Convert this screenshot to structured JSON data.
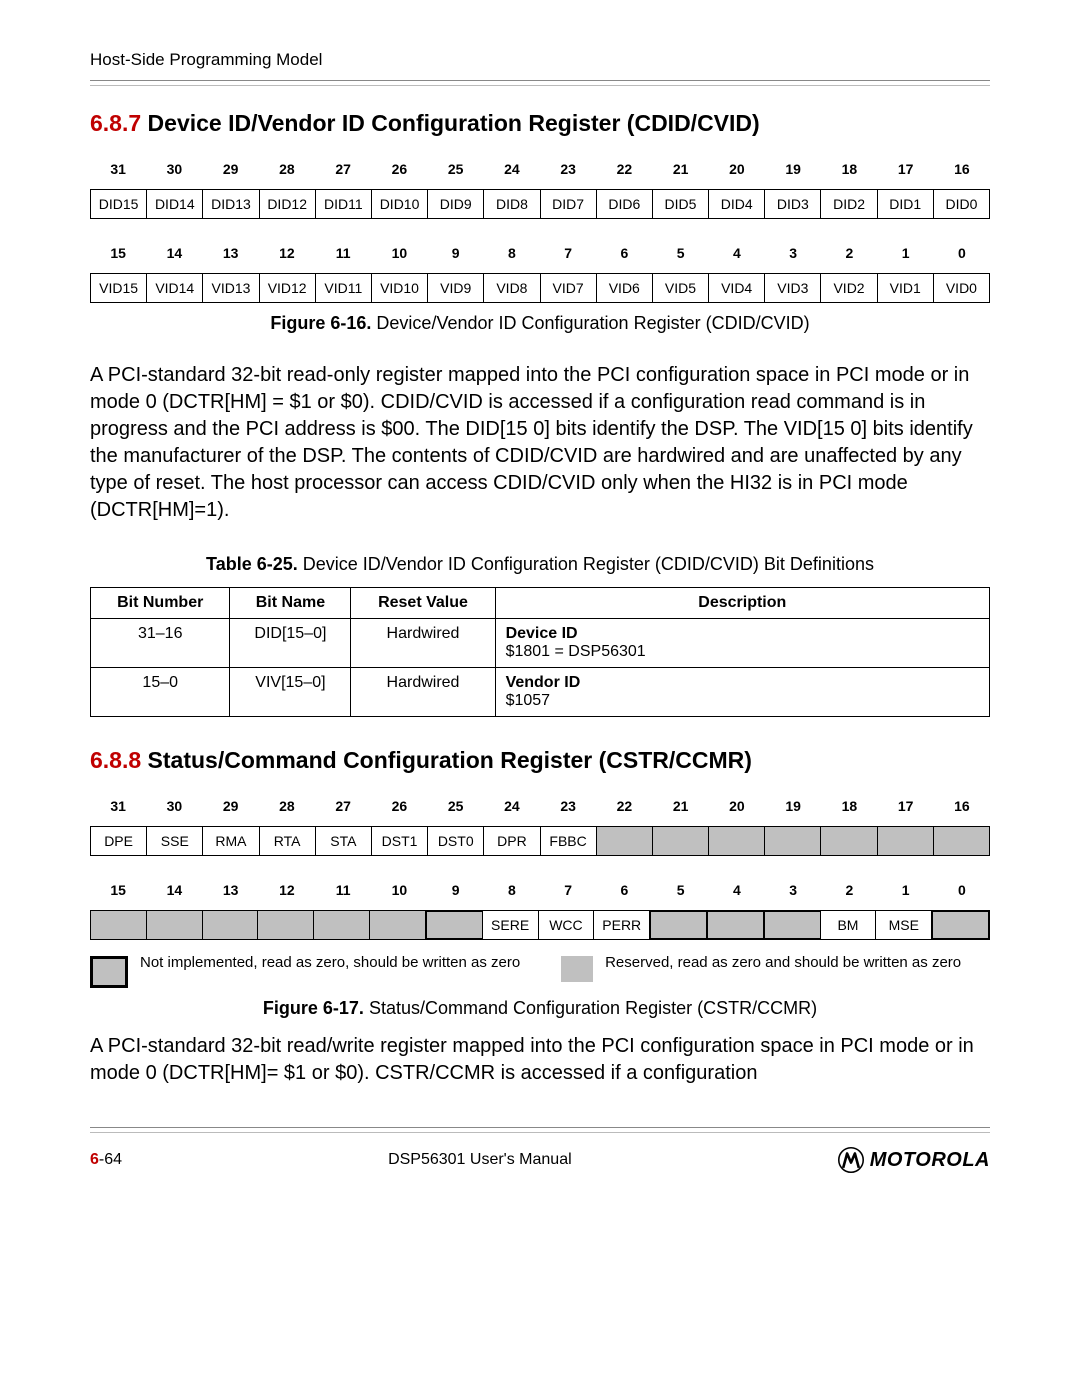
{
  "page": {
    "running_head": "Host-Side Programming Model",
    "footer_page_chapter": "6",
    "footer_page_num": "-64",
    "footer_center": "DSP56301 User's Manual",
    "footer_logo_text": "MOTOROLA"
  },
  "sec687": {
    "num": "6.8.7",
    "title": " Device ID/Vendor ID Configuration Register (CDID/CVID)",
    "fig_label": "Figure 6-16.",
    "fig_title": " Device/Vendor ID Configuration Register (CDID/CVID)",
    "body": "A PCI-standard 32-bit read-only register mapped into the PCI configuration space in PCI mode or in mode 0 (DCTR[HM] = $1 or $0). CDID/CVID is accessed if a configuration read command is in progress and the PCI address is $00. The DID[15 0] bits identify the DSP. The VID[15 0] bits identify the manufacturer of the DSP. The contents of CDID/CVID are hardwired and are unaffected by any type of reset. The host processor can access CDID/CVID only when the HI32 is in PCI mode (DCTR[HM]=1).",
    "row1_nums": [
      "31",
      "30",
      "29",
      "28",
      "27",
      "26",
      "25",
      "24",
      "23",
      "22",
      "21",
      "20",
      "19",
      "18",
      "17",
      "16"
    ],
    "row1_bits": [
      "DID15",
      "DID14",
      "DID13",
      "DID12",
      "DID11",
      "DID10",
      "DID9",
      "DID8",
      "DID7",
      "DID6",
      "DID5",
      "DID4",
      "DID3",
      "DID2",
      "DID1",
      "DID0"
    ],
    "row2_nums": [
      "15",
      "14",
      "13",
      "12",
      "11",
      "10",
      "9",
      "8",
      "7",
      "6",
      "5",
      "4",
      "3",
      "2",
      "1",
      "0"
    ],
    "row2_bits": [
      "VID15",
      "VID14",
      "VID13",
      "VID12",
      "VID11",
      "VID10",
      "VID9",
      "VID8",
      "VID7",
      "VID6",
      "VID5",
      "VID4",
      "VID3",
      "VID2",
      "VID1",
      "VID0"
    ]
  },
  "table625": {
    "label": "Table 6-25.",
    "title": " Device ID/Vendor ID Configuration Register (CDID/CVID) Bit Definitions",
    "headers": [
      "Bit Number",
      "Bit Name",
      "Reset Value",
      "Description"
    ],
    "rows": [
      {
        "num": "31–16",
        "name": "DID[15–0]",
        "reset": "Hardwired",
        "desc_b": "Device ID",
        "desc": "\n$1801 = DSP56301"
      },
      {
        "num": "15–0",
        "name": "VIV[15–0]",
        "reset": "Hardwired",
        "desc_b": "Vendor ID",
        "desc": "\n$1057"
      }
    ]
  },
  "sec688": {
    "num": "6.8.8",
    "title": " Status/Command Configuration Register (CSTR/CCMR)",
    "row1_nums": [
      "31",
      "30",
      "29",
      "28",
      "27",
      "26",
      "25",
      "24",
      "23",
      "22",
      "21",
      "20",
      "19",
      "18",
      "17",
      "16"
    ],
    "row1_bits": [
      {
        "t": "DPE",
        "gray": false
      },
      {
        "t": "SSE",
        "gray": false
      },
      {
        "t": "RMA",
        "gray": false
      },
      {
        "t": "RTA",
        "gray": false
      },
      {
        "t": "STA",
        "gray": false
      },
      {
        "t": "DST1",
        "gray": false
      },
      {
        "t": "DST0",
        "gray": false
      },
      {
        "t": "DPR",
        "gray": false
      },
      {
        "t": "FBBC",
        "gray": false
      },
      {
        "t": "",
        "gray": true
      },
      {
        "t": "",
        "gray": true
      },
      {
        "t": "",
        "gray": true
      },
      {
        "t": "",
        "gray": true
      },
      {
        "t": "",
        "gray": true
      },
      {
        "t": "",
        "gray": true
      },
      {
        "t": "",
        "gray": true
      }
    ],
    "row2_nums": [
      "15",
      "14",
      "13",
      "12",
      "11",
      "10",
      "9",
      "8",
      "7",
      "6",
      "5",
      "4",
      "3",
      "2",
      "1",
      "0"
    ],
    "row2_bits": [
      {
        "t": "",
        "gray": true
      },
      {
        "t": "",
        "gray": true
      },
      {
        "t": "",
        "gray": true
      },
      {
        "t": "",
        "gray": true
      },
      {
        "t": "",
        "gray": true
      },
      {
        "t": "",
        "gray": true
      },
      {
        "t": "",
        "gray": true,
        "thick": true
      },
      {
        "t": "SERE",
        "gray": false
      },
      {
        "t": "WCC",
        "gray": false
      },
      {
        "t": "PERR",
        "gray": false
      },
      {
        "t": "",
        "gray": true,
        "thick": true
      },
      {
        "t": "",
        "gray": true,
        "thick": true
      },
      {
        "t": "",
        "gray": true,
        "thick": true
      },
      {
        "t": "BM",
        "gray": false
      },
      {
        "t": "MSE",
        "gray": false
      },
      {
        "t": "",
        "gray": true,
        "thick": true
      }
    ],
    "legend1": "Not implemented, read as zero, should be written as zero",
    "legend2": "Reserved, read as zero and should be written as zero",
    "fig_label": "Figure 6-17.",
    "fig_title": " Status/Command Configuration Register (CSTR/CCMR)",
    "body": "A PCI-standard 32-bit read/write register mapped into the PCI configuration space in PCI mode or in mode 0 (DCTR[HM]= $1 or $0). CSTR/CCMR is accessed if a configuration"
  }
}
